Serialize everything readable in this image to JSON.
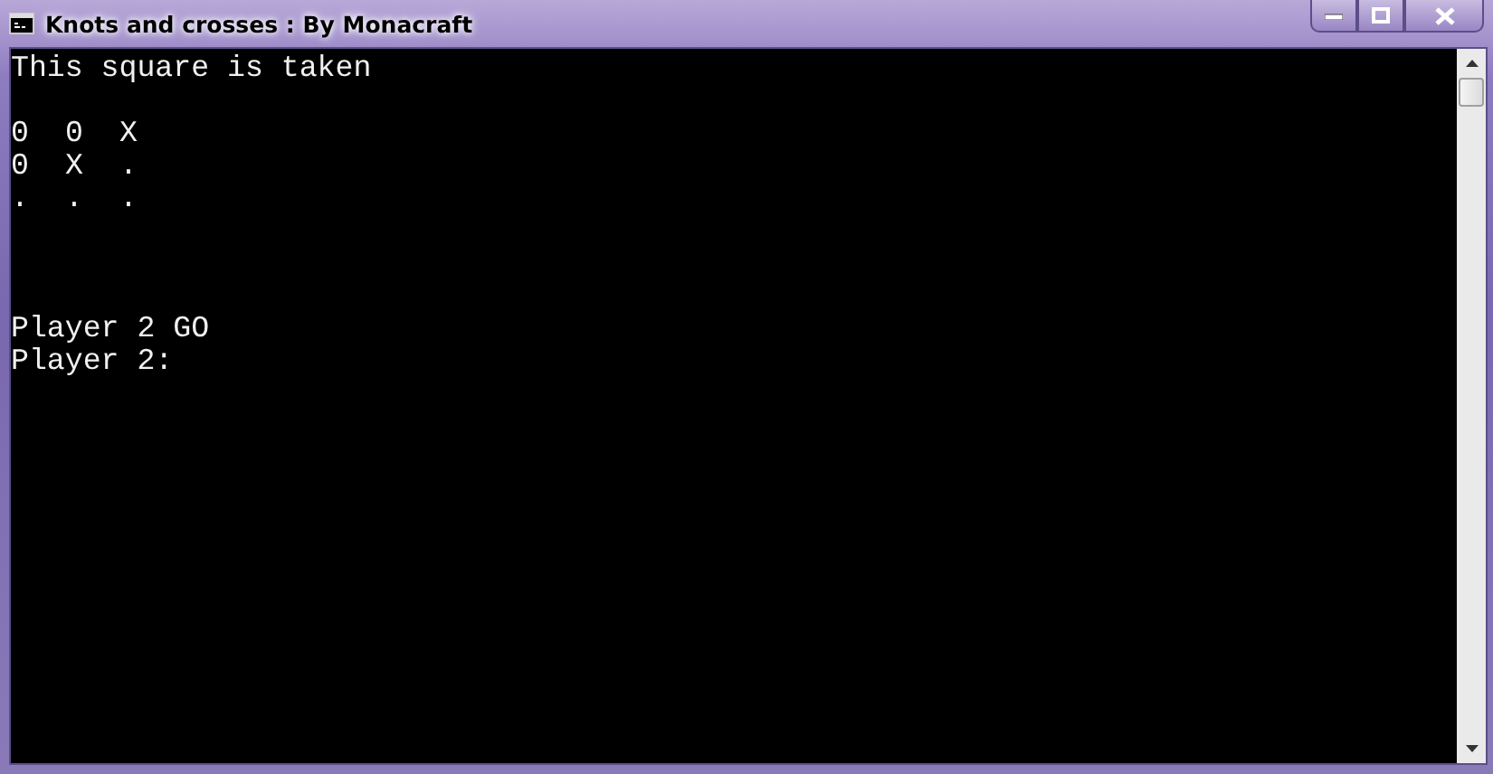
{
  "window": {
    "title": "Knots and crosses : By Monacraft"
  },
  "console": {
    "message": "This square is taken",
    "board": [
      [
        "0",
        "0",
        "X"
      ],
      [
        "0",
        "X",
        "."
      ],
      [
        ".",
        ".",
        "."
      ]
    ],
    "prompt_lines": [
      "Player 2 GO",
      "Player 2:"
    ]
  }
}
